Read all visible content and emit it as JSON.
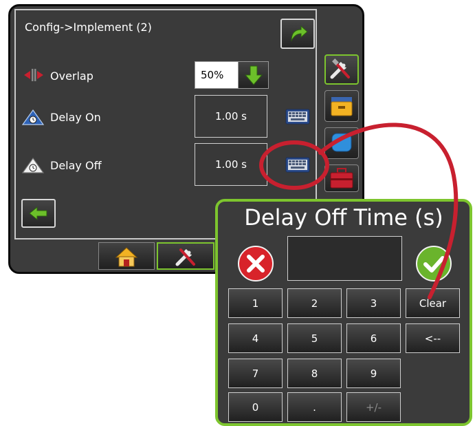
{
  "screen": {
    "title": "Config->Implement (2)",
    "rows": [
      {
        "label": "Overlap",
        "value": "50%"
      },
      {
        "label": "Delay On",
        "value": "1.00 s"
      },
      {
        "label": "Delay Off",
        "value": "1.00 s"
      }
    ]
  },
  "popup": {
    "title": "Delay Off Time (s)",
    "entry_value": "",
    "keys": {
      "k1": "1",
      "k2": "2",
      "k3": "3",
      "clear": "Clear",
      "k4": "4",
      "k5": "5",
      "k6": "6",
      "back": "<--",
      "k7": "7",
      "k8": "8",
      "k9": "9",
      "k0": "0",
      "dot": ".",
      "sign": "+/-"
    }
  },
  "colors": {
    "accent_green": "#7dc52e",
    "callout_red": "#c8202f",
    "cancel_red": "#d8232a",
    "ok_green": "#6ab42c"
  },
  "icons": [
    "next-arrow-icon",
    "overlap-icon",
    "down-arrow-icon",
    "delay-on-icon",
    "keyboard-icon",
    "delay-off-icon",
    "back-arrow-icon",
    "tools-icon",
    "implement-icon",
    "gps-icon",
    "toolbox-icon",
    "home-icon",
    "cancel-icon",
    "ok-icon"
  ]
}
